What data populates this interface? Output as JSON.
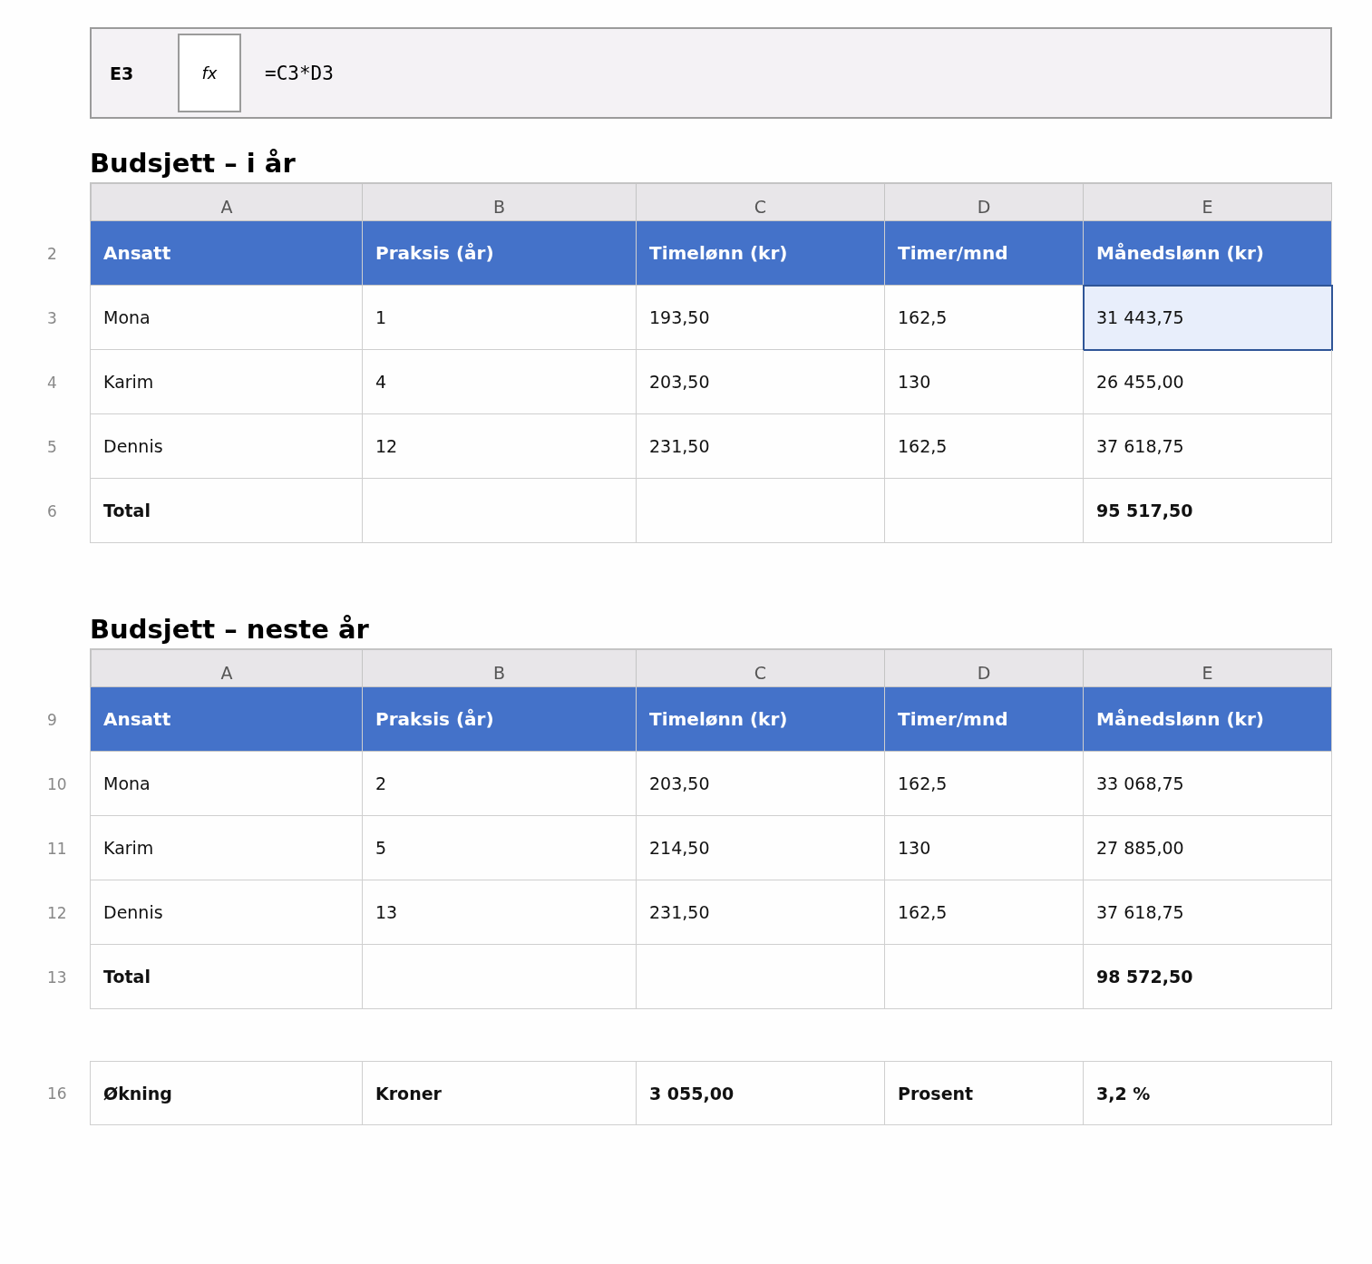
{
  "formula_bar": {
    "cell_ref": "E3",
    "fx": "fx",
    "formula": "=C3*D3"
  },
  "sections": [
    {
      "title": "Budsjett – i år",
      "column_headers": [
        "A",
        "B",
        "C",
        "D",
        "E"
      ],
      "rows": [
        {
          "row_number": "2",
          "kind": "header",
          "cells": [
            {
              "text": "Ansatt",
              "selected": false
            },
            {
              "text": "Praksis (år)",
              "selected": false
            },
            {
              "text": "Timelønn (kr)",
              "selected": false
            },
            {
              "text": "Timer/mnd",
              "selected": false
            },
            {
              "text": "Månedslønn (kr)",
              "selected": false
            }
          ]
        },
        {
          "row_number": "3",
          "kind": "data",
          "cells": [
            {
              "text": "Mona",
              "selected": false
            },
            {
              "text": "1",
              "selected": false
            },
            {
              "text": "193,50",
              "selected": false
            },
            {
              "text": "162,5",
              "selected": false
            },
            {
              "text": "31 443,75",
              "selected": true
            }
          ]
        },
        {
          "row_number": "4",
          "kind": "data",
          "cells": [
            {
              "text": "Karim",
              "selected": false
            },
            {
              "text": "4",
              "selected": false
            },
            {
              "text": "203,50",
              "selected": false
            },
            {
              "text": "130",
              "selected": false
            },
            {
              "text": "26 455,00",
              "selected": false
            }
          ]
        },
        {
          "row_number": "5",
          "kind": "data",
          "cells": [
            {
              "text": "Dennis",
              "selected": false
            },
            {
              "text": "12",
              "selected": false
            },
            {
              "text": "231,50",
              "selected": false
            },
            {
              "text": "162,5",
              "selected": false
            },
            {
              "text": "37 618,75",
              "selected": false
            }
          ]
        },
        {
          "row_number": "6",
          "kind": "total",
          "cells": [
            {
              "text": "Total",
              "selected": false
            },
            {
              "selected": false
            },
            {
              "selected": false
            },
            {
              "selected": false
            },
            {
              "text": "95 517,50",
              "selected": false
            }
          ]
        }
      ]
    },
    {
      "title": "Budsjett – neste år",
      "column_headers": [
        "A",
        "B",
        "C",
        "D",
        "E"
      ],
      "rows": [
        {
          "row_number": "9",
          "kind": "header",
          "cells": [
            {
              "text": "Ansatt",
              "selected": false
            },
            {
              "text": "Praksis (år)",
              "selected": false
            },
            {
              "text": "Timelønn (kr)",
              "selected": false
            },
            {
              "text": "Timer/mnd",
              "selected": false
            },
            {
              "text": "Månedslønn (kr)",
              "selected": false
            }
          ]
        },
        {
          "row_number": "10",
          "kind": "data",
          "cells": [
            {
              "text": "Mona",
              "selected": false
            },
            {
              "text": "2",
              "selected": false
            },
            {
              "text": "203,50",
              "selected": false
            },
            {
              "text": "162,5",
              "selected": false
            },
            {
              "text": "33 068,75",
              "selected": false
            }
          ]
        },
        {
          "row_number": "11",
          "kind": "data",
          "cells": [
            {
              "text": "Karim",
              "selected": false
            },
            {
              "text": "5",
              "selected": false
            },
            {
              "text": "214,50",
              "selected": false
            },
            {
              "text": "130",
              "selected": false
            },
            {
              "text": "27 885,00",
              "selected": false
            }
          ]
        },
        {
          "row_number": "12",
          "kind": "data",
          "cells": [
            {
              "text": "Dennis",
              "selected": false
            },
            {
              "text": "13",
              "selected": false
            },
            {
              "text": "231,50",
              "selected": false
            },
            {
              "text": "162,5",
              "selected": false
            },
            {
              "text": "37 618,75",
              "selected": false
            }
          ]
        },
        {
          "row_number": "13",
          "kind": "total",
          "cells": [
            {
              "text": "Total",
              "selected": false
            },
            {
              "selected": false
            },
            {
              "selected": false
            },
            {
              "selected": false
            },
            {
              "text": "98 572,50",
              "selected": false
            }
          ]
        }
      ]
    },
    {
      "rows": [
        {
          "row_number": "16",
          "kind": "total",
          "cells": [
            {
              "text": "Økning",
              "selected": false
            },
            {
              "text": "Kroner",
              "selected": false
            },
            {
              "text": "3 055,00",
              "selected": false
            },
            {
              "text": "Prosent",
              "selected": false
            },
            {
              "text": "3,2 %",
              "selected": false
            }
          ]
        }
      ]
    }
  ]
}
